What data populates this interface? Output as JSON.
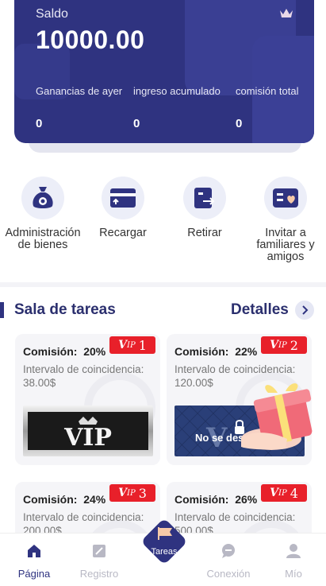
{
  "balance": {
    "label": "Saldo",
    "value": "10000.00",
    "stats": [
      {
        "label": "Ganancias de ayer",
        "value": "0"
      },
      {
        "label": "ingreso acumulado",
        "value": "0"
      },
      {
        "label": "comisión total",
        "value": "0"
      }
    ]
  },
  "actions": [
    {
      "label": "Administración de bienes",
      "icon": "money-bag-icon"
    },
    {
      "label": "Recargar",
      "icon": "card-icon"
    },
    {
      "label": "Retirar",
      "icon": "withdraw-icon"
    },
    {
      "label": "Invitar a familiares y amigos",
      "icon": "invite-card-icon"
    }
  ],
  "task_hall": {
    "title": "Sala de tareas",
    "details_label": "Detalles",
    "commission_label": "Comisión:",
    "interval_label": "Intervalo de coincidencia:",
    "locked_text": "No se desbl",
    "cards": [
      {
        "level": "1",
        "commission": "20%",
        "amount": "38.00$"
      },
      {
        "level": "2",
        "commission": "22%",
        "amount": "120.00$"
      },
      {
        "level": "3",
        "commission": "24%",
        "amount": "200.00$"
      },
      {
        "level": "4",
        "commission": "26%",
        "amount": "500.00$"
      }
    ]
  },
  "tabbar": {
    "items": [
      {
        "label": "Página",
        "active": true
      },
      {
        "label": "Registro",
        "active": false
      },
      {
        "label": "Tareas",
        "active": false
      },
      {
        "label": "Conexión",
        "active": false
      },
      {
        "label": "Mío",
        "active": false
      }
    ]
  },
  "colors": {
    "primary": "#2f3380",
    "vip_red": "#e8202a",
    "action_bg": "#eceef8"
  }
}
